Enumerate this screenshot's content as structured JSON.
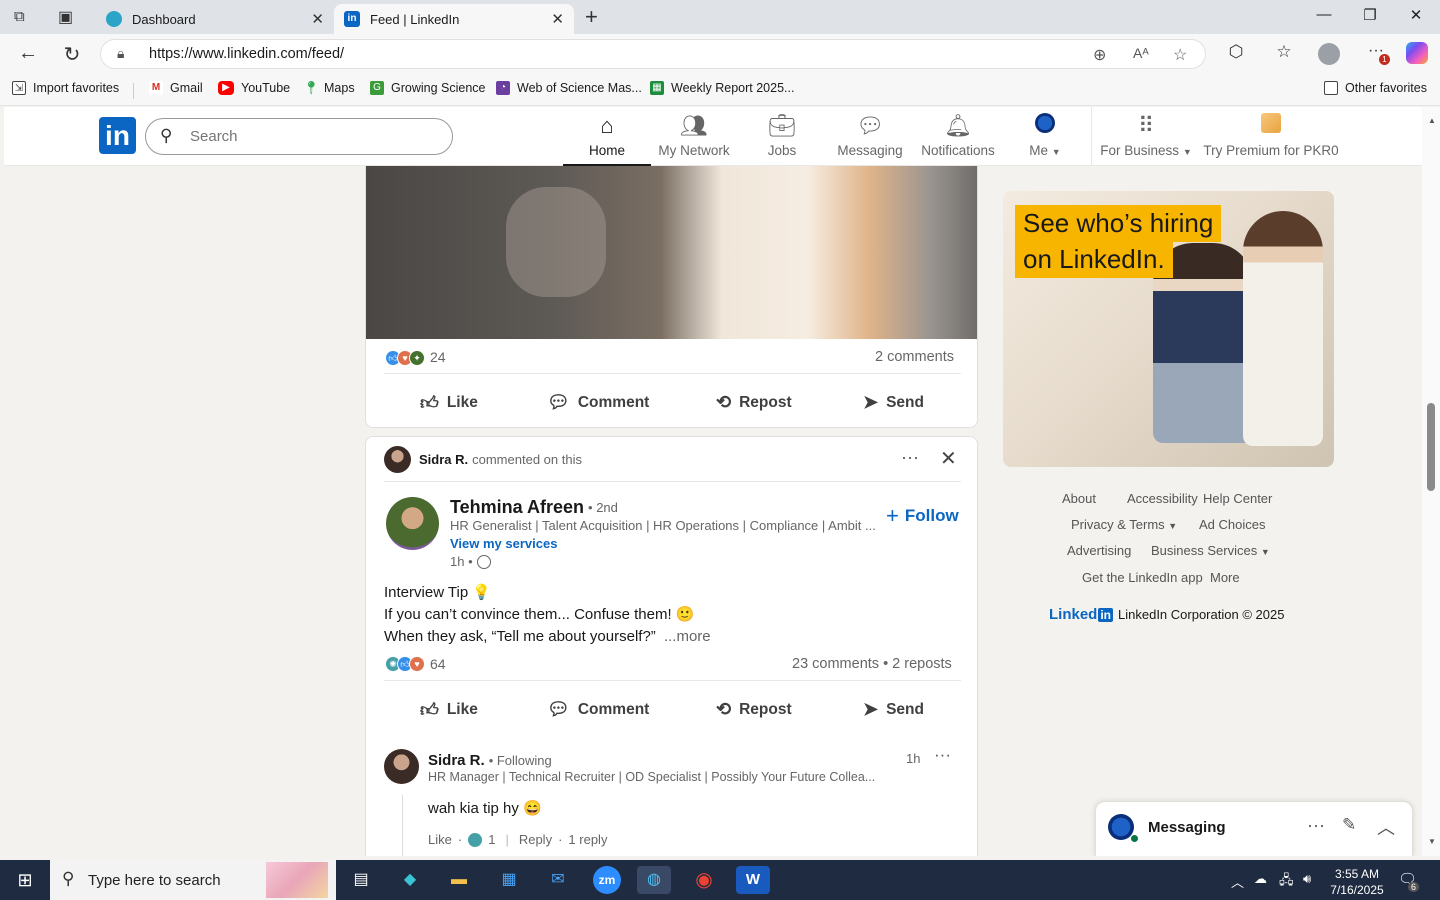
{
  "browser": {
    "tabs": [
      {
        "title": "Dashboard",
        "icon": "dashboard-icon"
      },
      {
        "title": "Feed | LinkedIn",
        "icon": "linkedin-icon"
      }
    ],
    "url": "https://www.linkedin.com/feed/",
    "favorites": [
      "Import favorites",
      "Gmail",
      "YouTube",
      "Maps",
      "Growing Science",
      "Web of Science Mas...",
      "Weekly Report 2025..."
    ],
    "other_favorites": "Other favorites",
    "notification_count": "1"
  },
  "linkedin": {
    "logo": "in",
    "search_placeholder": "Search",
    "nav": [
      {
        "label": "Home",
        "icon": "home-icon",
        "active": true
      },
      {
        "label": "My Network",
        "icon": "network-icon"
      },
      {
        "label": "Jobs",
        "icon": "briefcase-icon"
      },
      {
        "label": "Messaging",
        "icon": "messaging-icon"
      },
      {
        "label": "Notifications",
        "icon": "bell-icon"
      },
      {
        "label": "Me",
        "icon": "avatar-icon"
      }
    ],
    "for_business": "For Business",
    "premium": "Try Premium for PKR0"
  },
  "post1": {
    "reaction_count": "24",
    "comments": "2 comments",
    "actions": [
      "Like",
      "Comment",
      "Repost",
      "Send"
    ]
  },
  "post2": {
    "context_name": "Sidra R.",
    "context_text": "commented on this",
    "author": "Tehmina Afreen",
    "degree": "• 2nd",
    "headline": "HR Generalist | Talent Acquisition | HR Operations | Compliance | Ambit ...",
    "view_services": "View my services",
    "time": "1h •",
    "follow": "Follow",
    "line1": "Interview Tip 💡",
    "line2": "If you can’t convince them... Confuse them! 🙂",
    "line3": "When they ask, “Tell me about yourself?”",
    "more": "...more",
    "reaction_count": "64",
    "stats": "23 comments • 2 reposts",
    "actions": [
      "Like",
      "Comment",
      "Repost",
      "Send"
    ],
    "comment": {
      "name": "Sidra R.",
      "following": "• Following",
      "headline": "HR Manager | Technical Recruiter | OD Specialist | Possibly Your Future Collea...",
      "time": "1h",
      "text": "wah kia tip hy 😄",
      "like": "Like",
      "reaction_count": "1",
      "reply": "Reply",
      "replies": "1 reply"
    }
  },
  "ad": {
    "line1": "See who’s hiring",
    "line2": "on LinkedIn."
  },
  "footer": {
    "links": [
      "About",
      "Accessibility",
      "Help Center",
      "Privacy & Terms",
      "Ad Choices",
      "Advertising",
      "Business Services",
      "Get the LinkedIn app",
      "More"
    ],
    "brand": "Linked",
    "brand_in": "in",
    "copyright": "LinkedIn Corporation © 2025"
  },
  "messaging": {
    "label": "Messaging"
  },
  "taskbar": {
    "search_placeholder": "Type here to search",
    "time": "3:55 AM",
    "date": "7/16/2025",
    "notif_count": "6"
  }
}
